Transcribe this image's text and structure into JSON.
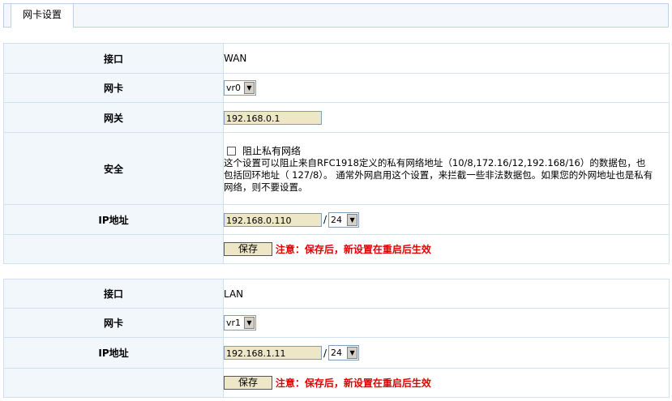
{
  "tab": {
    "label": "网卡设置"
  },
  "wan": {
    "interface_label": "接口",
    "interface_value": "WAN",
    "nic_label": "网卡",
    "nic_value": "vr0",
    "gateway_label": "网关",
    "gateway_value": "192.168.0.1",
    "security_label": "安全",
    "block_private_label": "阻止私有网络",
    "security_desc": "这个设置可以阻止来自RFC1918定义的私有网络地址（10/8,172.16/12,192.168/16）的数据包，也包括回环地址（ 127/8）。 通常外网启用这个设置，来拦截一些非法数据包。如果您的外网地址也是私有网络，则不要设置。",
    "ip_label": "IP地址",
    "ip_value": "192.168.0.110",
    "mask_value": "24",
    "save_label": "保存",
    "note": "注意：保存后，新设置在重启后生效"
  },
  "lan": {
    "interface_label": "接口",
    "interface_value": "LAN",
    "nic_label": "网卡",
    "nic_value": "vr1",
    "ip_label": "IP地址",
    "ip_value": "192.168.1.11",
    "mask_value": "24",
    "save_label": "保存",
    "note": "注意：保存后，新设置在重启后生效"
  },
  "slash": "/",
  "icons": {
    "dropdown": "chevron-down-icon",
    "checkbox": "checkbox-icon"
  },
  "colors": {
    "warning": "#e00000",
    "label_bg": "#f2f7fc",
    "border": "#cfe0f1",
    "input_bg": "#ede7c7"
  }
}
